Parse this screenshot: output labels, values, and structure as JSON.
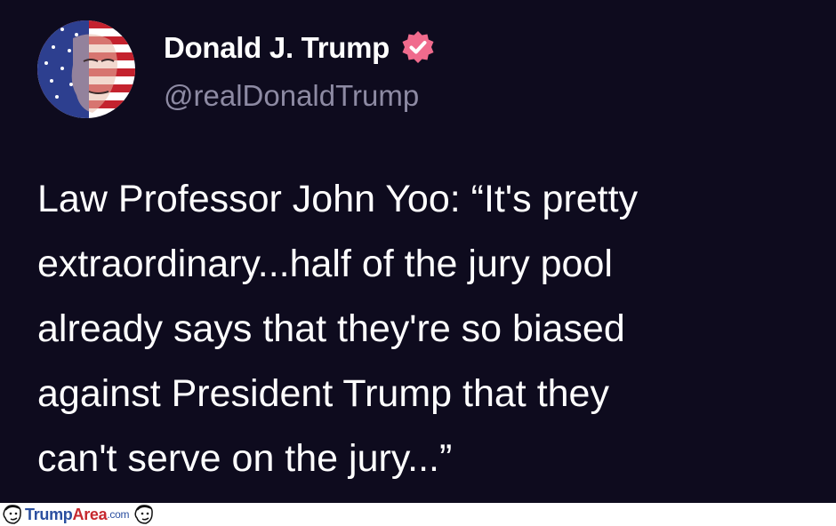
{
  "post": {
    "author": {
      "display_name": "Donald J. Trump",
      "handle": "@realDonaldTrump",
      "verified_icon": "verified-badge-icon",
      "verified_color": "#f06b8d"
    },
    "text": "Law Professor John Yoo: “It's pretty\nextraordinary...half of the jury pool\nalready says that they're so biased\nagainst President Trump that they\ncan't serve on the jury...”"
  },
  "watermark": {
    "part1": "Trump",
    "part2": "Area",
    "part3": ".com",
    "icon": "cartoon-face-icon"
  },
  "colors": {
    "background": "#0e0b1e",
    "text": "#ffffff",
    "handle": "#8d8aa3",
    "watermark_blue": "#2b4fa0",
    "watermark_red": "#c6282e"
  }
}
